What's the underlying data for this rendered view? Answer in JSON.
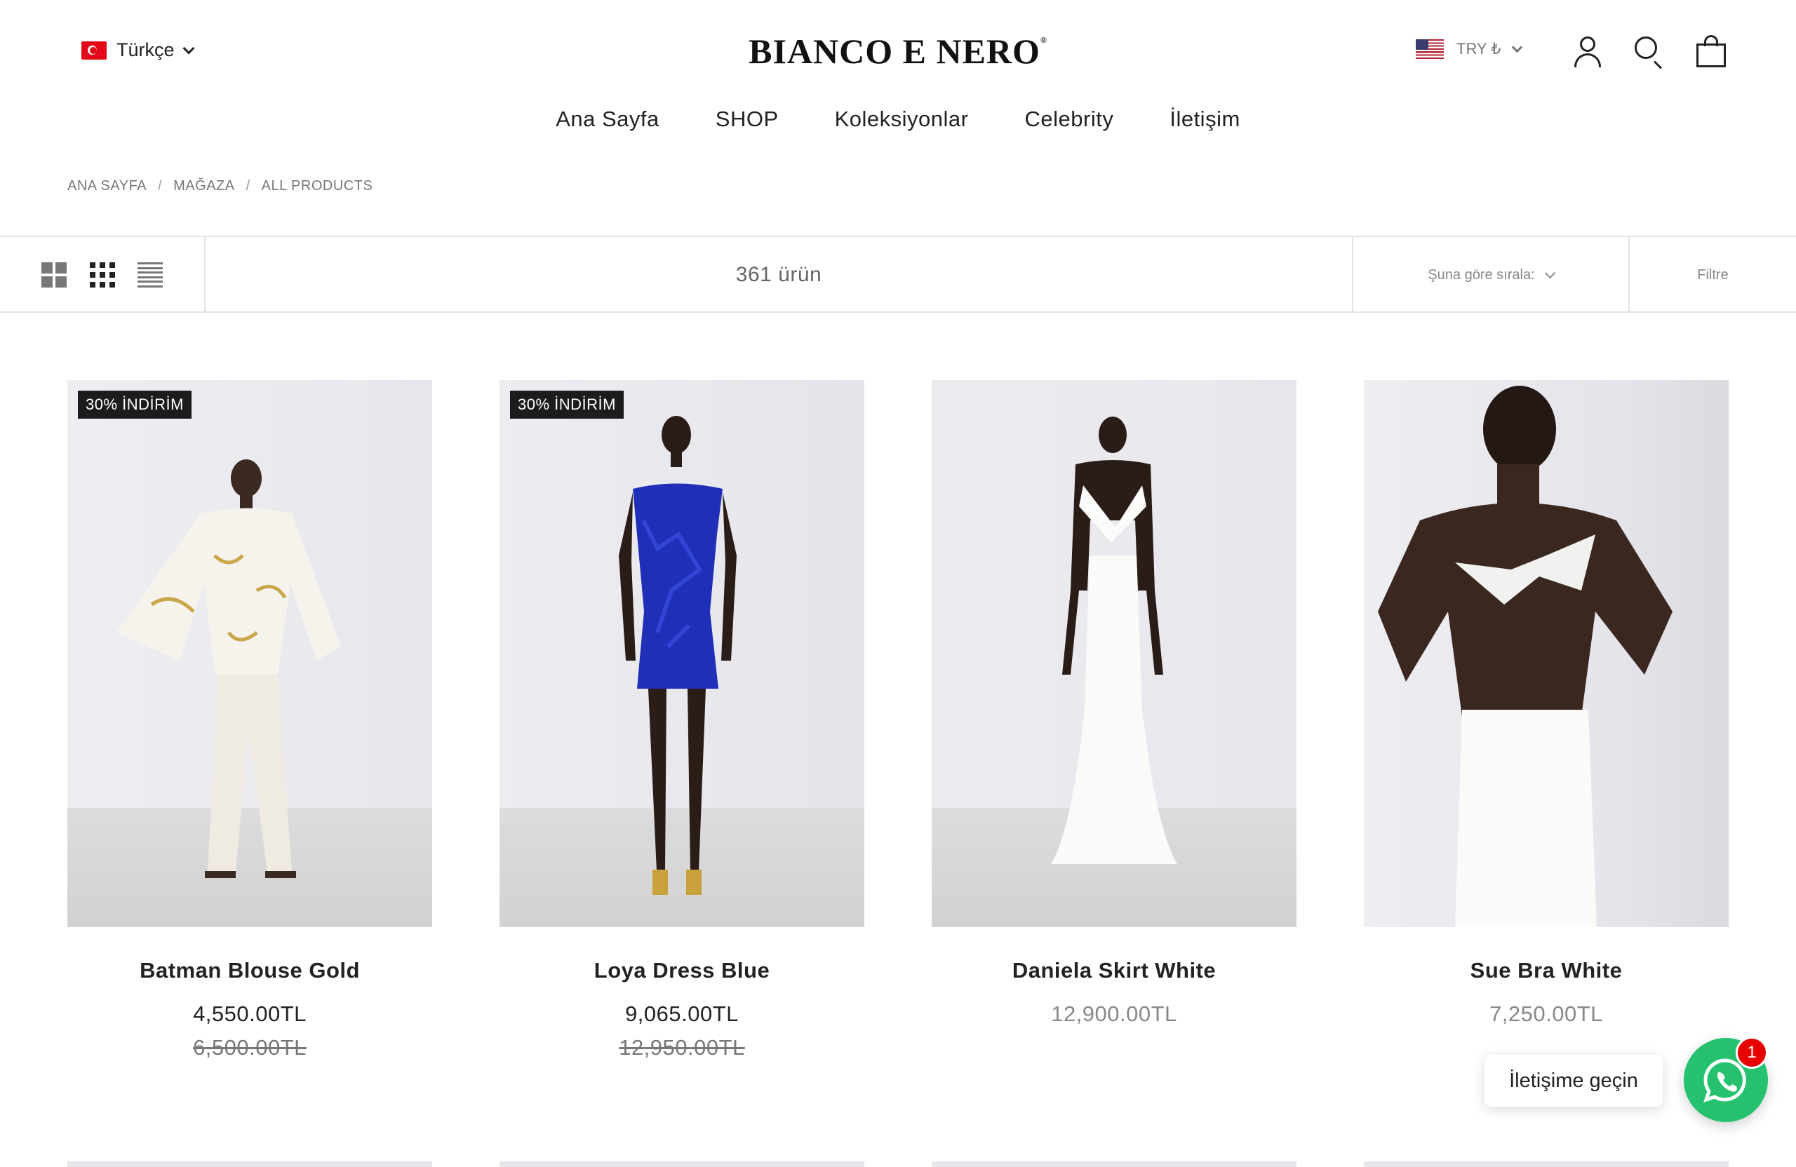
{
  "header": {
    "language": "Türkçe",
    "logo": "BIANCO E NERO",
    "logo_mark": "®",
    "currency": "TRY ₺"
  },
  "nav": [
    "Ana Sayfa",
    "SHOP",
    "Koleksiyonlar",
    "Celebrity",
    "İletişim"
  ],
  "breadcrumb": [
    "ANA SAYFA",
    "MAĞAZA",
    "ALL PRODUCTS"
  ],
  "toolbar": {
    "count": "361 ürün",
    "sort_label": "Şuna göre sırala:",
    "filter_label": "Filtre"
  },
  "products": [
    {
      "badge": "30% İNDİRİM",
      "title": "Batman Blouse Gold",
      "price": "4,550.00TL",
      "old_price": "6,500.00TL",
      "image": "model-white-blouse-trousers"
    },
    {
      "badge": "30% İNDİRİM",
      "title": "Loya Dress Blue",
      "price": "9,065.00TL",
      "old_price": "12,950.00TL",
      "image": "model-blue-sequin-dress"
    },
    {
      "title": "Daniela Skirt White",
      "price": "12,900.00TL",
      "image": "model-white-bra-skirt"
    },
    {
      "title": "Sue Bra White",
      "price": "7,250.00TL",
      "image": "model-white-bra-closeup"
    }
  ],
  "chat": {
    "label": "İletişime geçin",
    "unread": "1"
  },
  "colors": {
    "badge_bg": "#1c1c1c",
    "whatsapp": "#25c16f",
    "notification": "#e60000"
  }
}
